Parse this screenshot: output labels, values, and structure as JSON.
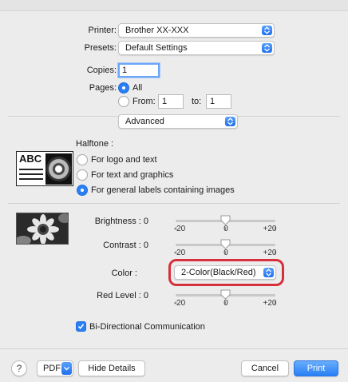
{
  "printer": {
    "label": "Printer:",
    "value": "Brother XX-XXX"
  },
  "presets": {
    "label": "Presets:",
    "value": "Default Settings"
  },
  "copies": {
    "label": "Copies:",
    "value": "1"
  },
  "pages": {
    "label": "Pages:",
    "all_label": "All",
    "from_label": "From:",
    "from_value": "1",
    "to_label": "to:",
    "to_value": "1",
    "selected": "all"
  },
  "section_popup": {
    "value": "Advanced"
  },
  "halftone": {
    "label": "Halftone :",
    "preview_text": "ABC",
    "options": [
      {
        "label": "For logo and text",
        "selected": false
      },
      {
        "label": "For text and graphics",
        "selected": false
      },
      {
        "label": "For general labels containing images",
        "selected": true
      }
    ]
  },
  "adjustments": {
    "brightness": {
      "label": "Brightness :",
      "value": "0",
      "level": 0,
      "min": -20,
      "max": 20,
      "min_label": "-20",
      "mid_label": "0",
      "max_label": "+20"
    },
    "contrast": {
      "label": "Contrast :",
      "value": "0",
      "level": 0,
      "min": -20,
      "max": 20,
      "min_label": "-20",
      "mid_label": "0",
      "max_label": "+20"
    },
    "color": {
      "label": "Color :",
      "value": "2-Color(Black/Red)"
    },
    "red_level": {
      "label": "Red Level :",
      "value": "0",
      "level": 0,
      "min": -20,
      "max": 20,
      "min_label": "-20",
      "mid_label": "0",
      "max_label": "+20"
    }
  },
  "bidirectional": {
    "label": "Bi-Directional Communication",
    "checked": true
  },
  "footer": {
    "help": "?",
    "pdf": "PDF",
    "hide_details": "Hide Details",
    "cancel": "Cancel",
    "print": "Print"
  },
  "colors": {
    "accent": "#2a7ff5",
    "highlight": "#d6303c",
    "background": "#ececec"
  }
}
